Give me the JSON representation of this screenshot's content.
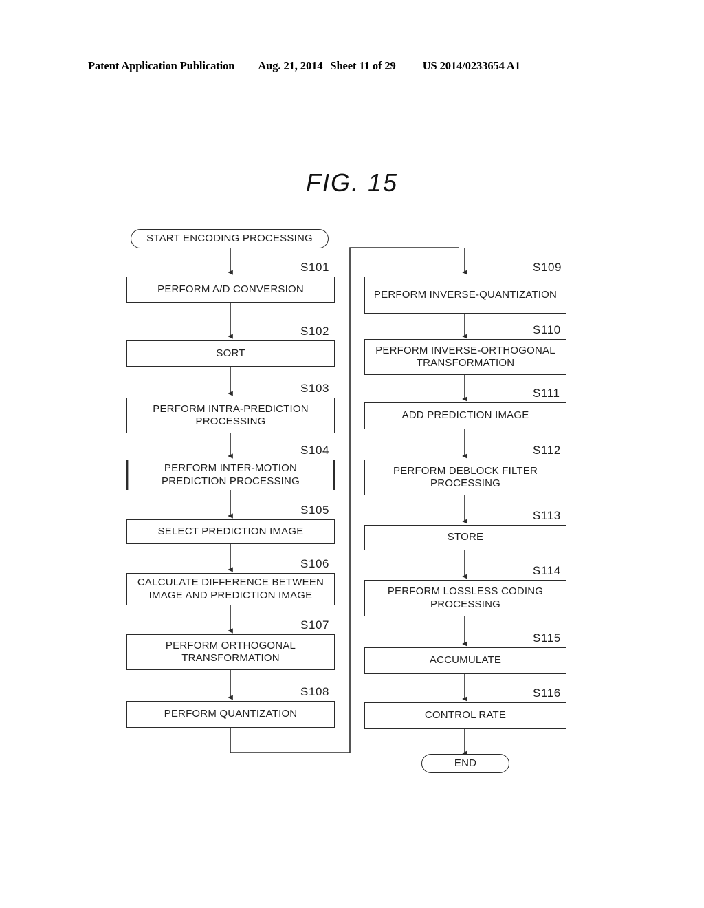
{
  "header": {
    "publication": "Patent Application Publication",
    "date": "Aug. 21, 2014",
    "sheet": "Sheet 11 of 29",
    "patent_number": "US 2014/0233654 A1"
  },
  "figure": {
    "title": "FIG. 15"
  },
  "flowchart": {
    "start": {
      "label": "START ENCODING PROCESSING"
    },
    "end": {
      "label": "END"
    },
    "left_column": [
      {
        "id": "S101",
        "label": "PERFORM A/D CONVERSION",
        "shape": "process"
      },
      {
        "id": "S102",
        "label": "SORT",
        "shape": "process"
      },
      {
        "id": "S103",
        "label": "PERFORM INTRA-PREDICTION PROCESSING",
        "shape": "process"
      },
      {
        "id": "S104",
        "label": "PERFORM INTER-MOTION PREDICTION PROCESSING",
        "shape": "predefined"
      },
      {
        "id": "S105",
        "label": "SELECT PREDICTION IMAGE",
        "shape": "process"
      },
      {
        "id": "S106",
        "label": "CALCULATE DIFFERENCE BETWEEN IMAGE AND PREDICTION IMAGE",
        "shape": "process"
      },
      {
        "id": "S107",
        "label": "PERFORM ORTHOGONAL TRANSFORMATION",
        "shape": "process"
      },
      {
        "id": "S108",
        "label": "PERFORM QUANTIZATION",
        "shape": "process"
      }
    ],
    "right_column": [
      {
        "id": "S109",
        "label": "PERFORM INVERSE-QUANTIZATION",
        "shape": "process"
      },
      {
        "id": "S110",
        "label": "PERFORM INVERSE-ORTHOGONAL TRANSFORMATION",
        "shape": "process"
      },
      {
        "id": "S111",
        "label": "ADD PREDICTION IMAGE",
        "shape": "process"
      },
      {
        "id": "S112",
        "label": "PERFORM DEBLOCK FILTER PROCESSING",
        "shape": "process"
      },
      {
        "id": "S113",
        "label": "STORE",
        "shape": "process"
      },
      {
        "id": "S114",
        "label": "PERFORM LOSSLESS CODING PROCESSING",
        "shape": "process"
      },
      {
        "id": "S115",
        "label": "ACCUMULATE",
        "shape": "process"
      },
      {
        "id": "S116",
        "label": "CONTROL RATE",
        "shape": "process"
      }
    ]
  }
}
